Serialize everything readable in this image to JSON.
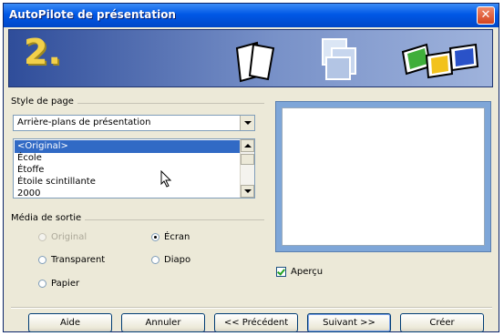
{
  "window": {
    "title": "AutoPilote de présentation"
  },
  "banner": {
    "step": "2."
  },
  "page_style": {
    "group_label": "Style de page",
    "combo_value": "Arrière-plans de présentation",
    "list_items": [
      "<Original>",
      "École",
      "Étoffe",
      "Étoile scintillante",
      "2000"
    ],
    "selected_index": 0
  },
  "output_media": {
    "group_label": "Média de sortie",
    "options": [
      {
        "label": "Original",
        "checked": false,
        "disabled": true
      },
      {
        "label": "Écran",
        "checked": true,
        "disabled": false
      },
      {
        "label": "Transparent",
        "checked": false,
        "disabled": false
      },
      {
        "label": "Diapo",
        "checked": false,
        "disabled": false
      },
      {
        "label": "Papier",
        "checked": false,
        "disabled": false
      }
    ]
  },
  "preview": {
    "checkbox_label": "Aperçu",
    "checked": true
  },
  "buttons": {
    "help": "Aide",
    "cancel": "Annuler",
    "previous": "<< Précédent",
    "next": "Suivant >>",
    "create": "Créer"
  }
}
